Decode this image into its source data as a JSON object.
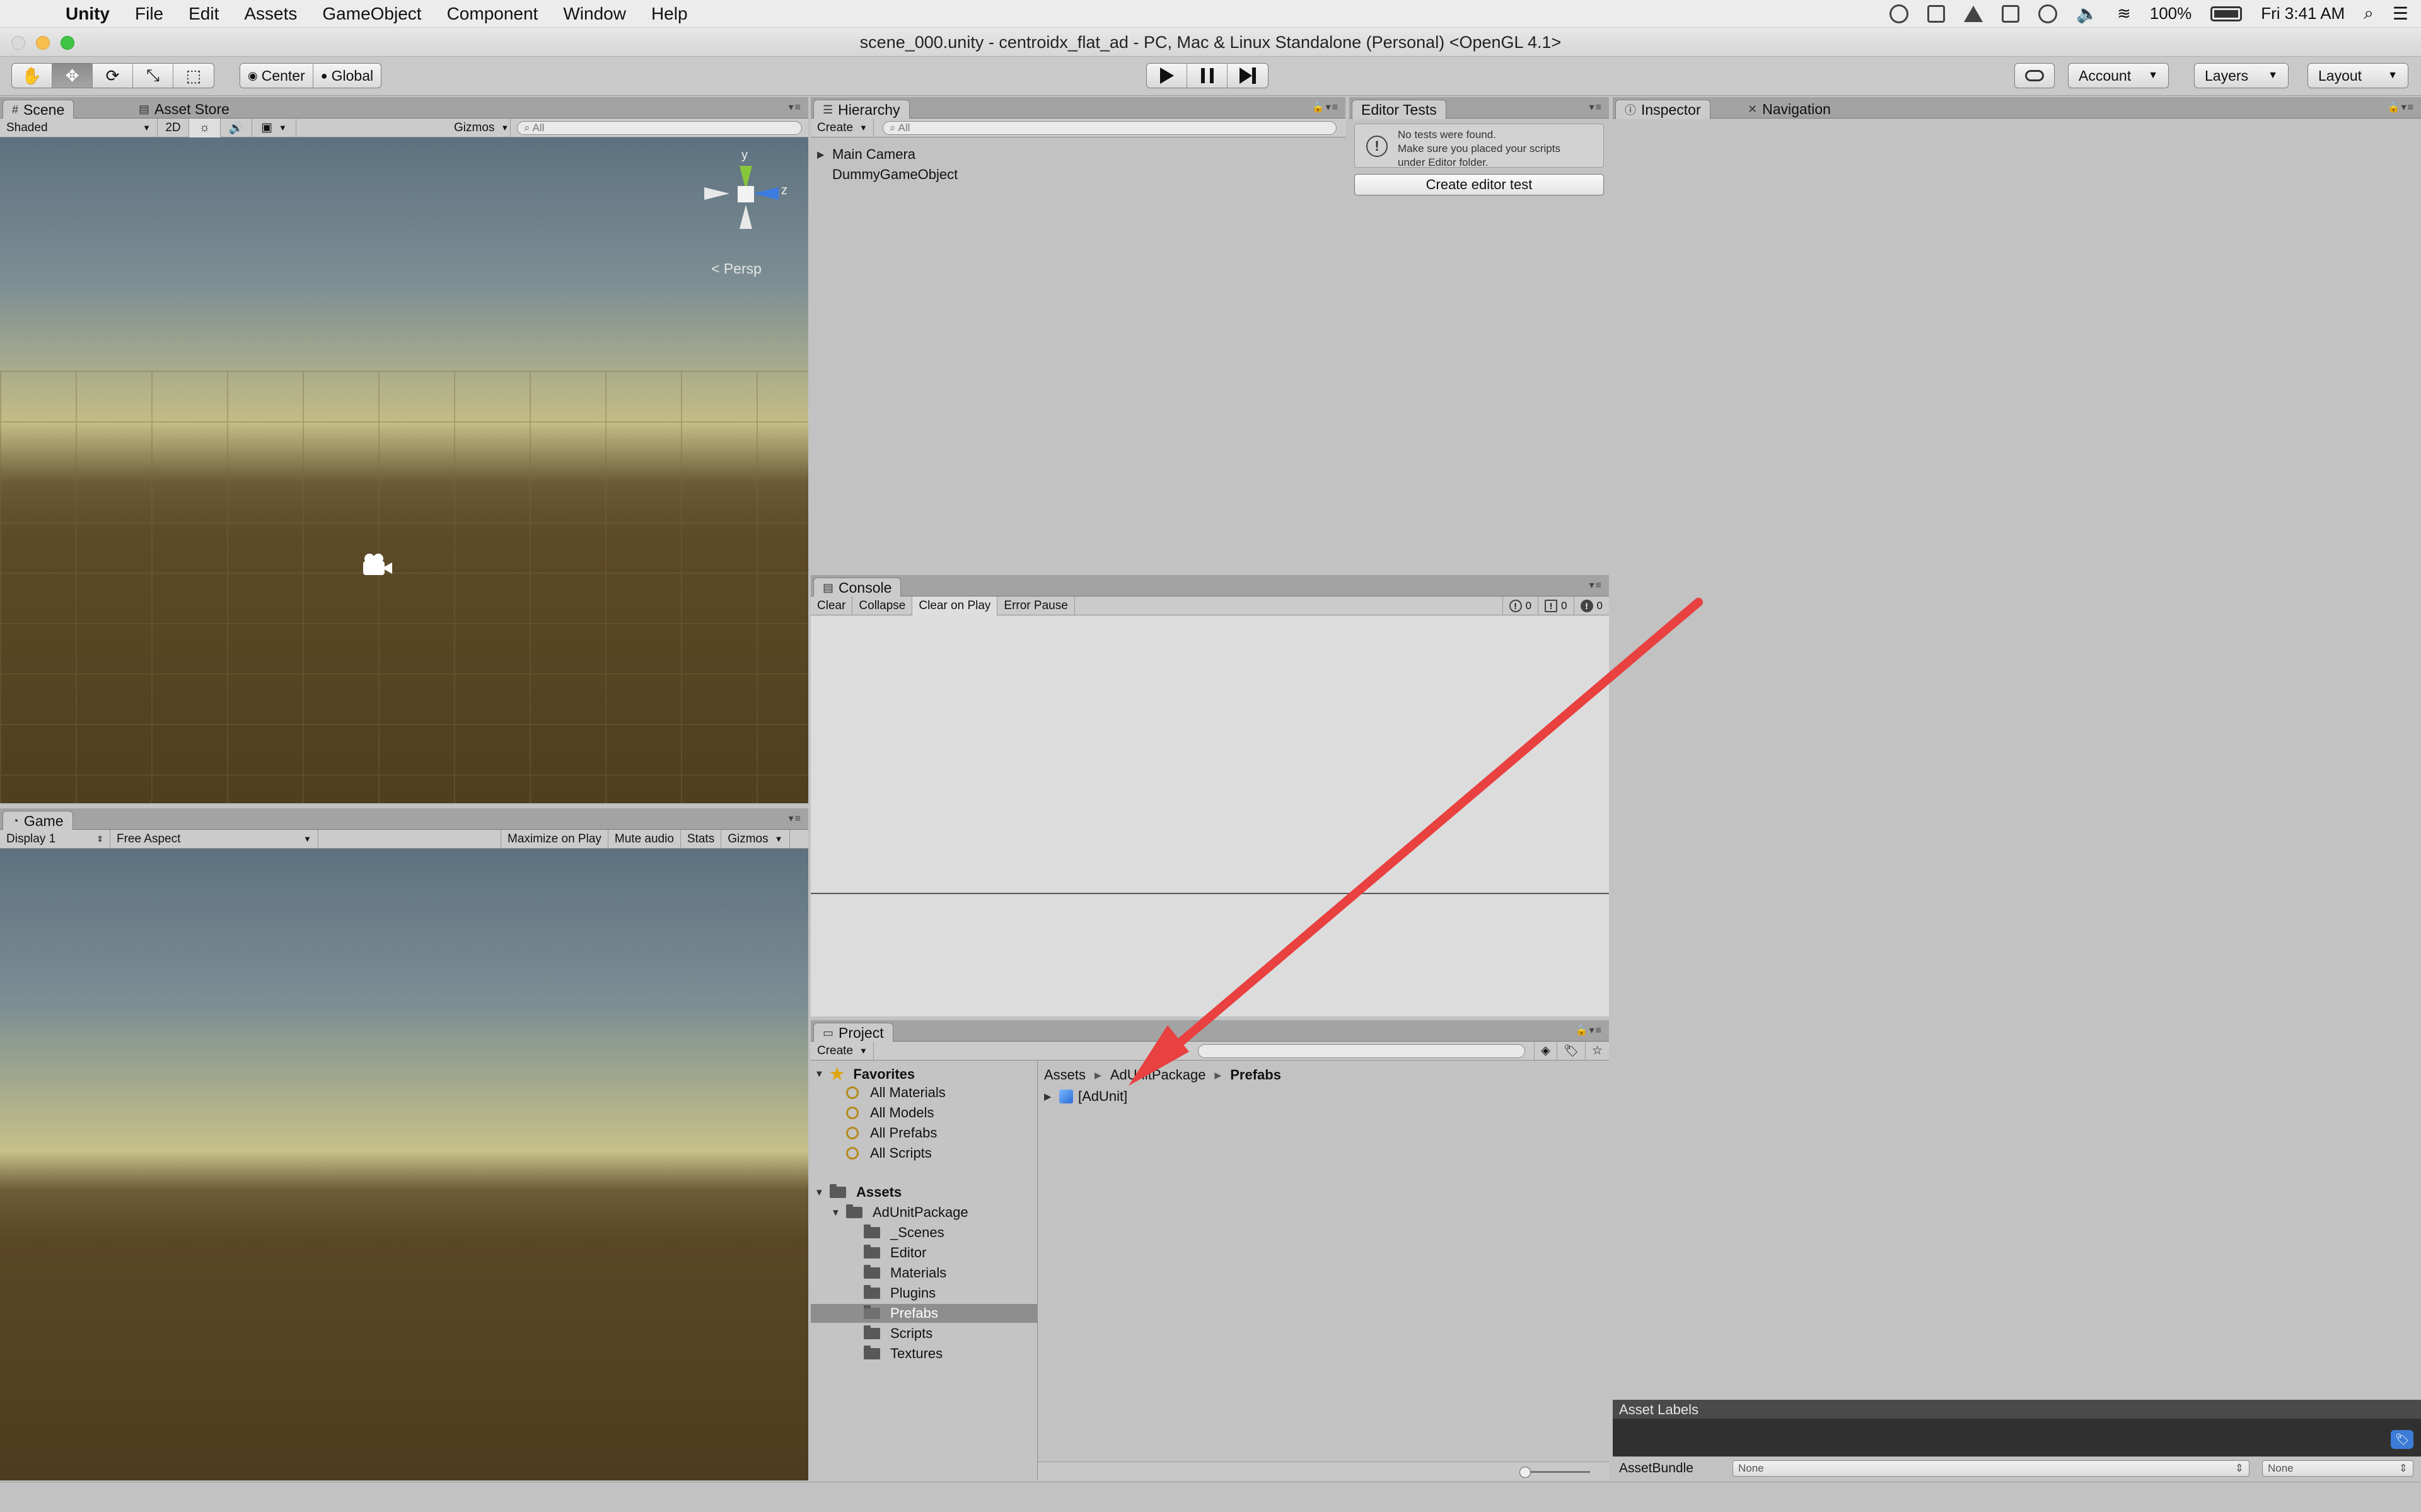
{
  "menubar": {
    "app": "Unity",
    "items": [
      "File",
      "Edit",
      "Assets",
      "GameObject",
      "Component",
      "Window",
      "Help"
    ],
    "battery": "100%",
    "clock": "Fri 3:41 AM"
  },
  "window": {
    "title": "scene_000.unity - centroidx_flat_ad - PC, Mac & Linux Standalone (Personal) <OpenGL 4.1>"
  },
  "toolbar": {
    "pivot": "Center",
    "space": "Global",
    "account": "Account",
    "layers": "Layers",
    "layout": "Layout"
  },
  "scene": {
    "tabs": [
      "Scene",
      "Asset Store"
    ],
    "shading": "Shaded",
    "mode_2d": "2D",
    "gizmos": "Gizmos",
    "search_placeholder": "All",
    "persp": "< Persp",
    "axis_y": "y",
    "axis_z": "z"
  },
  "game": {
    "tab": "Game",
    "display": "Display 1",
    "aspect": "Free Aspect",
    "maximize": "Maximize on Play",
    "mute": "Mute audio",
    "stats": "Stats",
    "gizmos": "Gizmos"
  },
  "hierarchy": {
    "tab": "Hierarchy",
    "create": "Create",
    "search_placeholder": "All",
    "items": [
      "Main Camera",
      "DummyGameObject"
    ]
  },
  "editor_tests": {
    "tab": "Editor Tests",
    "notice": [
      "No tests were found.",
      "Make sure you placed your scripts",
      "under Editor folder."
    ],
    "button": "Create editor test"
  },
  "console": {
    "tab": "Console",
    "buttons": [
      "Clear",
      "Collapse",
      "Clear on Play",
      "Error Pause"
    ],
    "log_count": "0",
    "warn_count": "0",
    "error_count": "0"
  },
  "project": {
    "tab": "Project",
    "create": "Create",
    "favorites_label": "Favorites",
    "favorites": [
      "All Materials",
      "All Models",
      "All Prefabs",
      "All Scripts"
    ],
    "assets_label": "Assets",
    "package": "AdUnitPackage",
    "folders": [
      "_Scenes",
      "Editor",
      "Materials",
      "Plugins",
      "Prefabs",
      "Scripts",
      "Textures"
    ],
    "selected_folder": "Prefabs",
    "breadcrumb": [
      "Assets",
      "AdUnitPackage",
      "Prefabs"
    ],
    "files": [
      "[AdUnit]"
    ]
  },
  "inspector": {
    "tabs": [
      "Inspector",
      "Navigation"
    ],
    "asset_labels": "Asset Labels",
    "assetbundle_label": "AssetBundle",
    "assetbundle_value": "None",
    "variant_value": "None"
  },
  "colors": {
    "annotation_arrow": "#e94040"
  }
}
